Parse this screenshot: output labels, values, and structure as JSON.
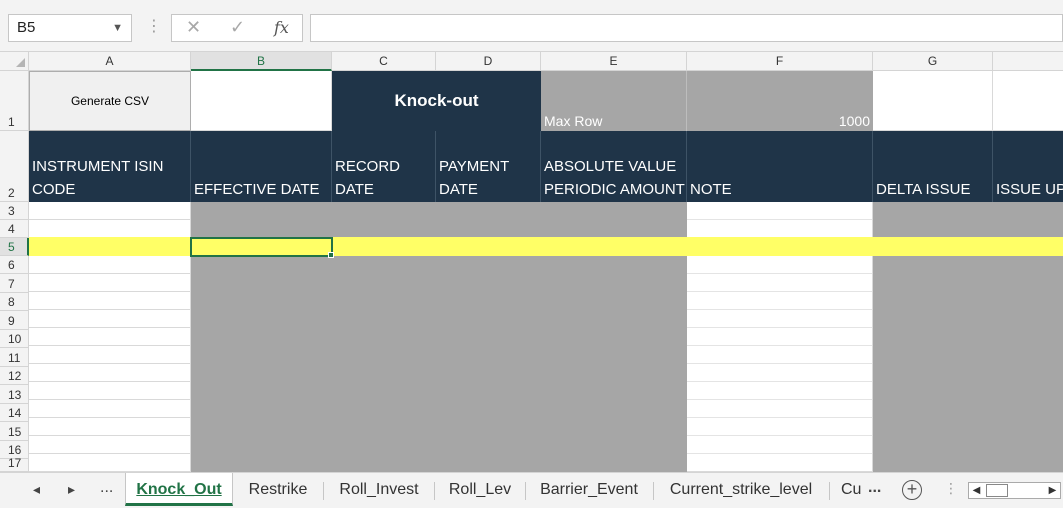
{
  "formula_bar": {
    "name_box": "B5",
    "cancel_icon": "✕",
    "enter_icon": "✓",
    "function_icon": "fx",
    "formula_value": ""
  },
  "columns": [
    "A",
    "B",
    "C",
    "D",
    "E",
    "F",
    "G"
  ],
  "selected_column": "B",
  "rows": [
    "1",
    "2",
    "3",
    "4",
    "5",
    "6",
    "7",
    "8",
    "9",
    "10",
    "11",
    "12",
    "13",
    "14",
    "15",
    "16",
    "17"
  ],
  "selected_row": "5",
  "row1": {
    "generate_csv": "Generate CSV",
    "title": "Knock-out",
    "max_row_label": "Max Row",
    "max_row_value": "1000"
  },
  "headers": {
    "instrument_isin_line1": "INSTRUMENT ISIN",
    "instrument_isin_line2": "CODE",
    "effective_date": "EFFECTIVE DATE",
    "record_line1": "RECORD",
    "record_line2": "DATE",
    "payment_line1": "PAYMENT",
    "payment_line2": "DATE",
    "abs_line1": "ABSOLUTE VALUE",
    "abs_line2": "PERIODIC AMOUNT",
    "note": "NOTE",
    "delta_issue": "DELTA ISSUE",
    "issue_up": "ISSUE UPI"
  },
  "sheet_tabs": {
    "more_left": "...",
    "active": "Knock_Out",
    "t2": "Restrike",
    "t3": "Roll_Invest",
    "t4": "Roll_Lev",
    "t5": "Barrier_Event",
    "t6": "Current_strike_level",
    "t7": "Cu",
    "more_right": "..."
  },
  "colors": {
    "header_navy": "#1f3448",
    "grey_fill": "#a6a6a6",
    "selected_row_yellow": "#ffff66",
    "excel_green": "#217346"
  }
}
